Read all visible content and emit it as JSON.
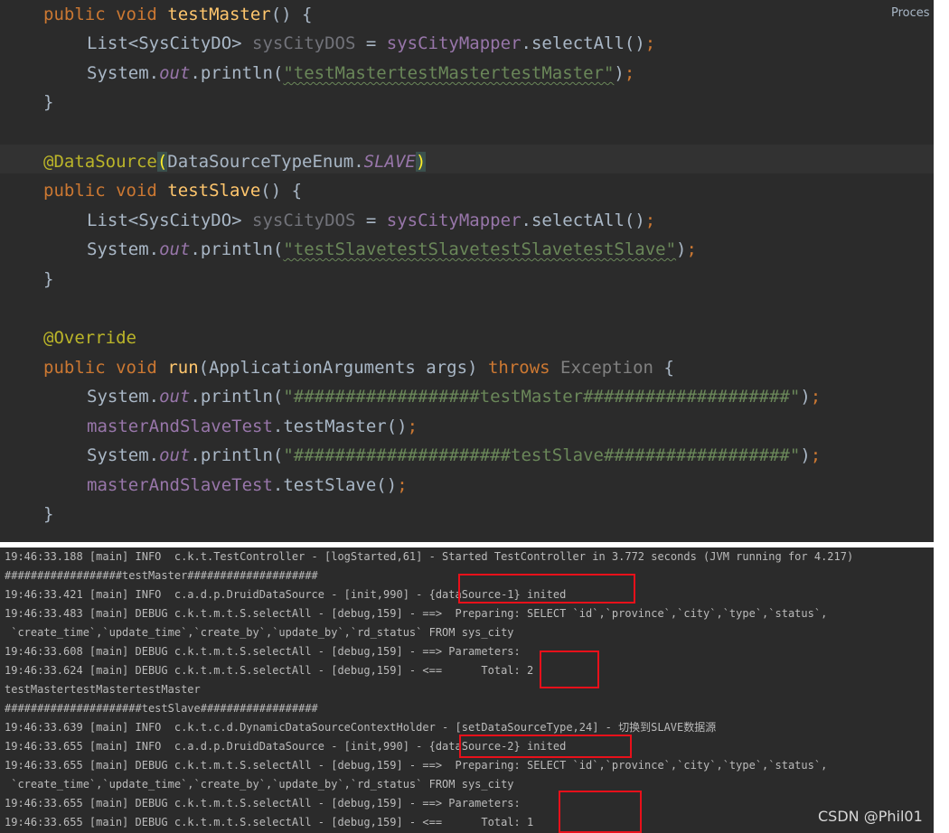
{
  "editor": {
    "process_tab": "Proces",
    "code": {
      "l1_kw1": "public",
      "l1_kw2": "void",
      "l1_name": "testMaster",
      "l1_rest": "() {",
      "l2_type": "List<SysCityDO>",
      "l2_var": "sysCityDOS",
      "l2_eq": "=",
      "l2_mapper": "sysCityMapper",
      "l2_call": ".selectAll()",
      "semi": ";",
      "l3_sys": "System.",
      "out": "out",
      "println": ".println(",
      "l3_str": "\"testMastertestMastertestMaster\"",
      "close_paren": ")",
      "brace_close": "}",
      "l5_ann": "@DataSource",
      "l5_open": "(",
      "l5_enum": "DataSourceTypeEnum.",
      "l5_slave": "SLAVE",
      "l5_close": ")",
      "l6_name": "testSlave",
      "l8_str": "\"testSlavetestSlavetestSlavetestSlave\"",
      "l11_ann": "@Override",
      "l12_name": "run",
      "l12_params": "(ApplicationArguments args)",
      "l12_throws": "throws",
      "l12_exc": "Exception",
      "l12_brace": "{",
      "l13_str": "\"##################testMaster####################\"",
      "l14_obj": "masterAndSlaveTest",
      "l14_call": ".testMaster()",
      "l15_str": "\"#####################testSlave##################\"",
      "l16_call": ".testSlave()"
    }
  },
  "console": {
    "lines": [
      "19:46:33.188 [main] INFO  c.k.t.TestController - [logStarted,61] - Started TestController in 3.772 seconds (JVM running for 4.217)",
      "##################testMaster####################",
      "19:46:33.421 [main] INFO  c.a.d.p.DruidDataSource - [init,990] - {dataSource-1} inited",
      "19:46:33.483 [main] DEBUG c.k.t.m.t.S.selectAll - [debug,159] - ==>  Preparing: SELECT `id`,`province`,`city`,`type`,`status`,",
      " `create_time`,`update_time`,`create_by`,`update_by`,`rd_status` FROM sys_city",
      "19:46:33.608 [main] DEBUG c.k.t.m.t.S.selectAll - [debug,159] - ==> Parameters:",
      "19:46:33.624 [main] DEBUG c.k.t.m.t.S.selectAll - [debug,159] - <==      Total: 2",
      "testMastertestMastertestMaster",
      "#####################testSlave##################",
      "19:46:33.639 [main] INFO  c.k.t.c.d.DynamicDataSourceContextHolder - [setDataSourceType,24] - 切换到SLAVE数据源",
      "19:46:33.655 [main] INFO  c.a.d.p.DruidDataSource - [init,990] - {dataSource-2} inited",
      "19:46:33.655 [main] DEBUG c.k.t.m.t.S.selectAll - [debug,159] - ==>  Preparing: SELECT `id`,`province`,`city`,`type`,`status`,",
      " `create_time`,`update_time`,`create_by`,`update_by`,`rd_status` FROM sys_city",
      "19:46:33.655 [main] DEBUG c.k.t.m.t.S.selectAll - [debug,159] - ==> Parameters:",
      "19:46:33.655 [main] DEBUG c.k.t.m.t.S.selectAll - [debug,159] - <==      Total: 1"
    ]
  },
  "watermark": "CSDN @Phil01",
  "colors": {
    "editor_bg": "#2b2b2b",
    "keyword": "#cc7832",
    "method": "#ffc66d",
    "annotation": "#bbb529",
    "string": "#6a8759",
    "field": "#9876aa",
    "highlight_box": "#e8101a"
  }
}
